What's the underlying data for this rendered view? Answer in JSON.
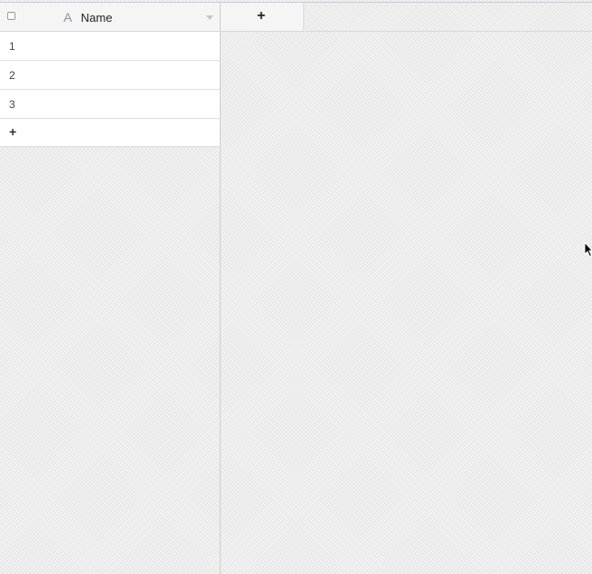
{
  "header": {
    "field_type_icon": "text-field-icon",
    "field_type_glyph": "A",
    "column_name": "Name",
    "menu_icon": "chevron-down-icon",
    "add_column_icon": "plus-icon",
    "add_column_glyph": "+"
  },
  "rows": [
    {
      "id": "1"
    },
    {
      "id": "2"
    },
    {
      "id": "3"
    }
  ],
  "add_row": {
    "icon": "plus-icon",
    "glyph": "+"
  },
  "colors": {
    "background": "#f3f3f3",
    "row_background": "#ffffff",
    "header_background": "#f5f5f5",
    "border": "#d7d7e3"
  }
}
